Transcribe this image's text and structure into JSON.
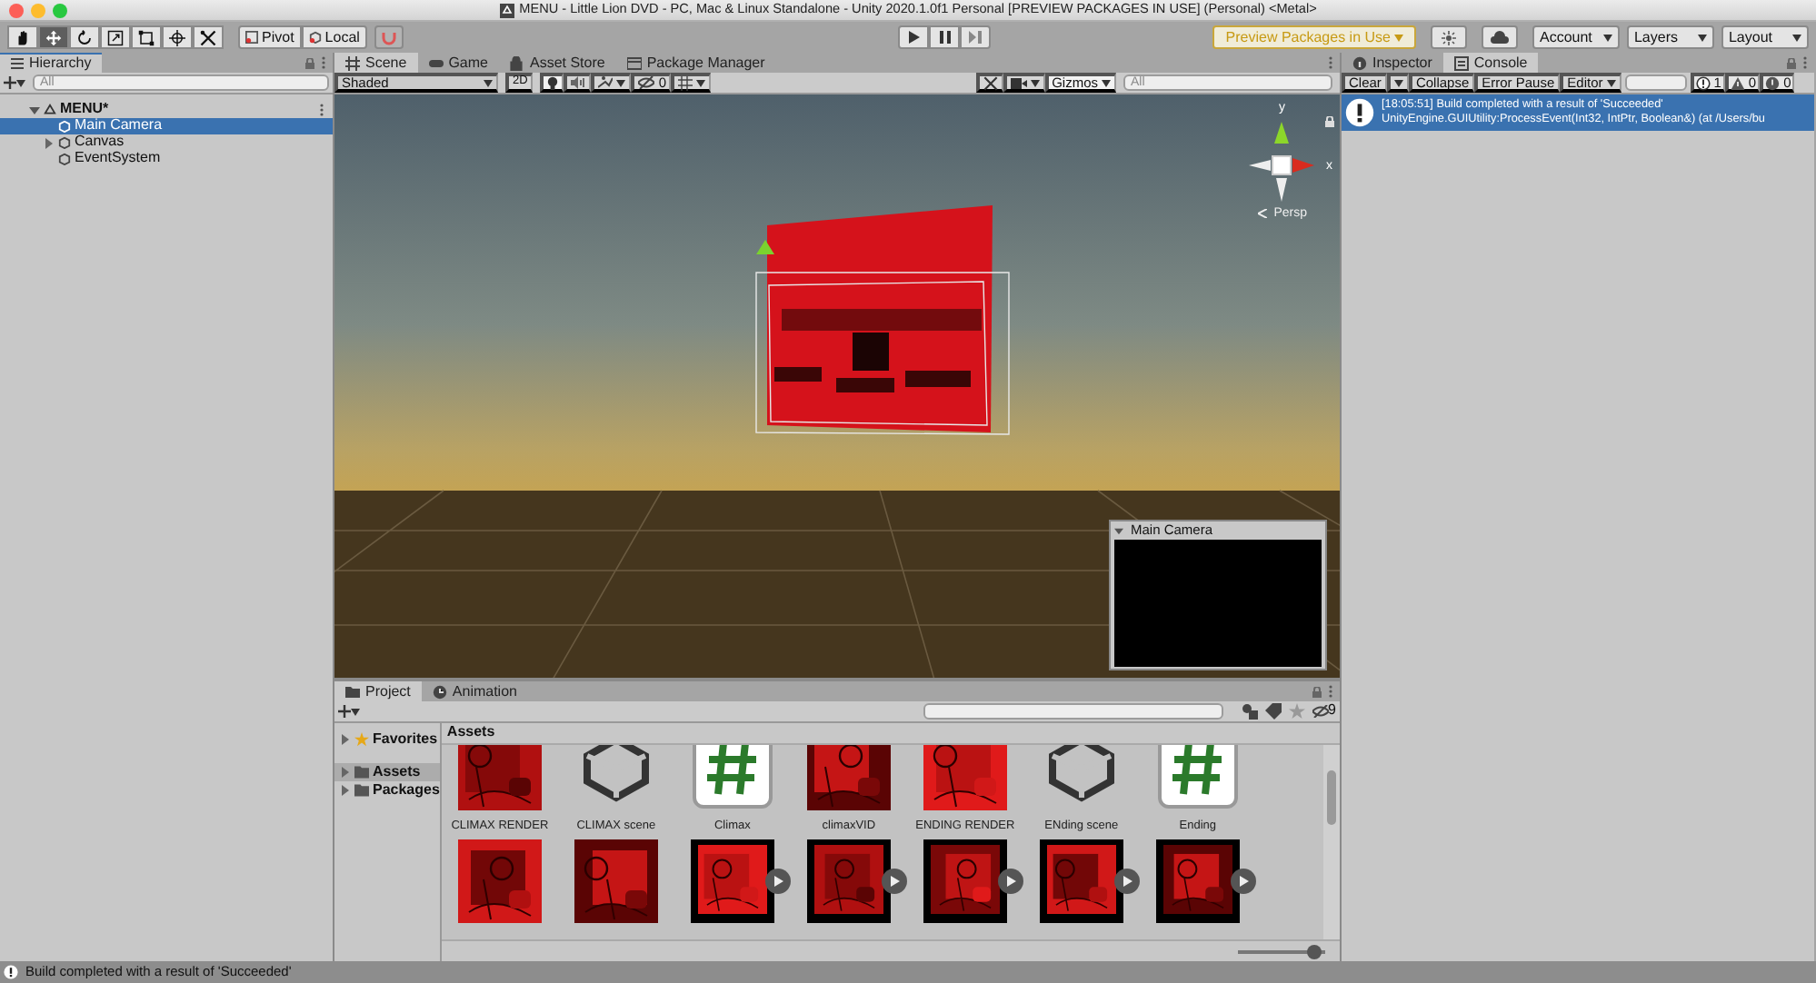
{
  "window": {
    "title": "MENU - Little Lion DVD - PC, Mac & Linux Standalone - Unity 2020.1.0f1 Personal [PREVIEW PACKAGES IN USE] (Personal) <Metal>"
  },
  "toolbar": {
    "tools": [
      {
        "kind": "hand",
        "selected": false
      },
      {
        "kind": "move",
        "selected": true
      },
      {
        "kind": "rotate",
        "selected": false
      },
      {
        "kind": "scale",
        "selected": false
      },
      {
        "kind": "rect",
        "selected": false
      },
      {
        "kind": "transform",
        "selected": false
      },
      {
        "kind": "custom",
        "selected": false
      }
    ],
    "pivot": "Pivot",
    "local": "Local",
    "preview_packages": "Preview Packages in Use",
    "menus": [
      "Account",
      "Layers",
      "Layout"
    ]
  },
  "hierarchy": {
    "tab": "Hierarchy",
    "search_placeholder": "All",
    "scene": {
      "name": "MENU*",
      "expanded": true,
      "children": [
        {
          "name": "Main Camera",
          "selected": true
        },
        {
          "name": "Canvas",
          "selected": false,
          "expanded": false
        },
        {
          "name": "EventSystem",
          "selected": false
        }
      ]
    }
  },
  "scene_tabs": [
    {
      "label": "Scene",
      "kind": "scene",
      "selected": true
    },
    {
      "label": "Game",
      "kind": "game",
      "selected": false
    },
    {
      "label": "Asset Store",
      "kind": "store",
      "selected": false
    },
    {
      "label": "Package Manager",
      "kind": "package",
      "selected": false
    }
  ],
  "scene_toolbar": {
    "draw_mode": "Shaded",
    "mode_2d": "2D",
    "mode_2d_on": false,
    "lighting_on": true,
    "audio_on": false,
    "hidden_count": "0",
    "gizmos": "Gizmos",
    "search_placeholder": "All"
  },
  "scene_view": {
    "kind": "picture",
    "projection": "Persp",
    "axis_labels": [
      "y",
      "x"
    ],
    "camera_preview": {
      "title": "Main Camera"
    }
  },
  "project": {
    "tabs": [
      {
        "label": "Project",
        "kind": "folder",
        "selected": true
      },
      {
        "label": "Animation",
        "kind": "clock",
        "selected": false
      }
    ],
    "hidden_count": "9",
    "tree": [
      {
        "label": "Favorites",
        "kind": "star",
        "selected": false
      },
      {
        "label": "Assets",
        "kind": "folder",
        "selected": true
      },
      {
        "label": "Packages",
        "kind": "folder",
        "selected": false
      }
    ],
    "breadcrumb": "Assets",
    "assets": [
      {
        "kind": "picture",
        "label": "CLIMAX RENDER"
      },
      {
        "kind": "unity",
        "label": "CLIMAX scene"
      },
      {
        "kind": "script",
        "label": "Climax"
      },
      {
        "kind": "picture",
        "label": "climaxVID"
      },
      {
        "kind": "picture",
        "label": "ENDING RENDER"
      },
      {
        "kind": "unity",
        "label": "ENding scene"
      },
      {
        "kind": "script",
        "label": "Ending"
      },
      {
        "kind": "picture"
      },
      {
        "kind": "picture"
      },
      {
        "kind": "video"
      },
      {
        "kind": "video"
      },
      {
        "kind": "video"
      },
      {
        "kind": "video"
      },
      {
        "kind": "video"
      }
    ],
    "icon_size": {
      "level": 0.95
    }
  },
  "inspector_tabs": [
    {
      "label": "Inspector",
      "kind": "info",
      "selected": false
    },
    {
      "label": "Console",
      "kind": "console",
      "selected": true
    }
  ],
  "console": {
    "buttons": [
      "Clear",
      "Collapse",
      "Error Pause",
      "Editor"
    ],
    "counts": [
      {
        "kind": "info",
        "count": "1"
      },
      {
        "kind": "warning",
        "count": "0"
      },
      {
        "kind": "error",
        "count": "0"
      }
    ],
    "messages": [
      {
        "kind": "info",
        "selected": true,
        "lines": [
          "[18:05:51] Build completed with a result of 'Succeeded'",
          "UnityEngine.GUIUtility:ProcessEvent(Int32, IntPtr, Boolean&) (at /Users/bu"
        ]
      }
    ]
  },
  "status_bar": {
    "kind": "info",
    "text": "Build completed with a result of 'Succeeded'"
  }
}
